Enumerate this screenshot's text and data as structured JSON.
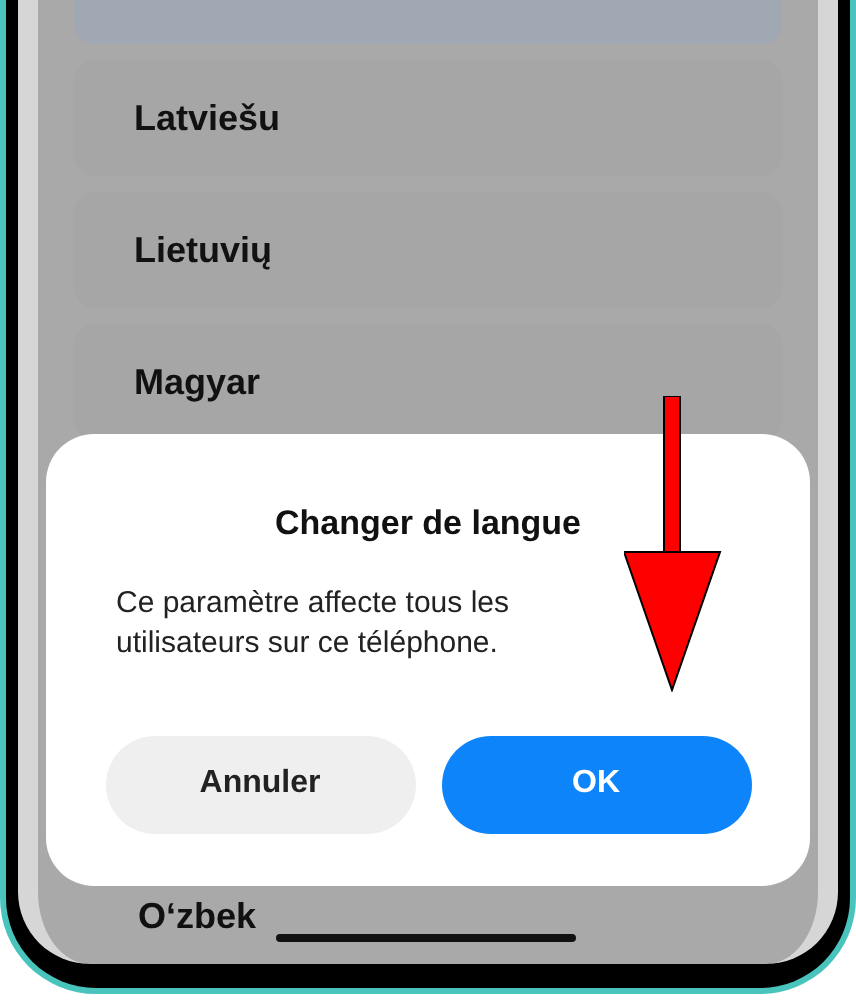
{
  "languages": [
    {
      "selected": true
    },
    {
      "label": "Latviešu",
      "selected": false
    },
    {
      "label": "Lietuvių",
      "selected": false
    },
    {
      "label": "Magyar",
      "selected": false
    }
  ],
  "dialog": {
    "title": "Changer de langue",
    "message": "Ce paramètre affecte tous les utilisateurs sur ce téléphone.",
    "buttons": [
      {
        "label": "Annuler",
        "kind": "secondary"
      },
      {
        "label": "OK",
        "kind": "primary"
      }
    ]
  },
  "below_dialog": {
    "label": "O‘zbek"
  }
}
